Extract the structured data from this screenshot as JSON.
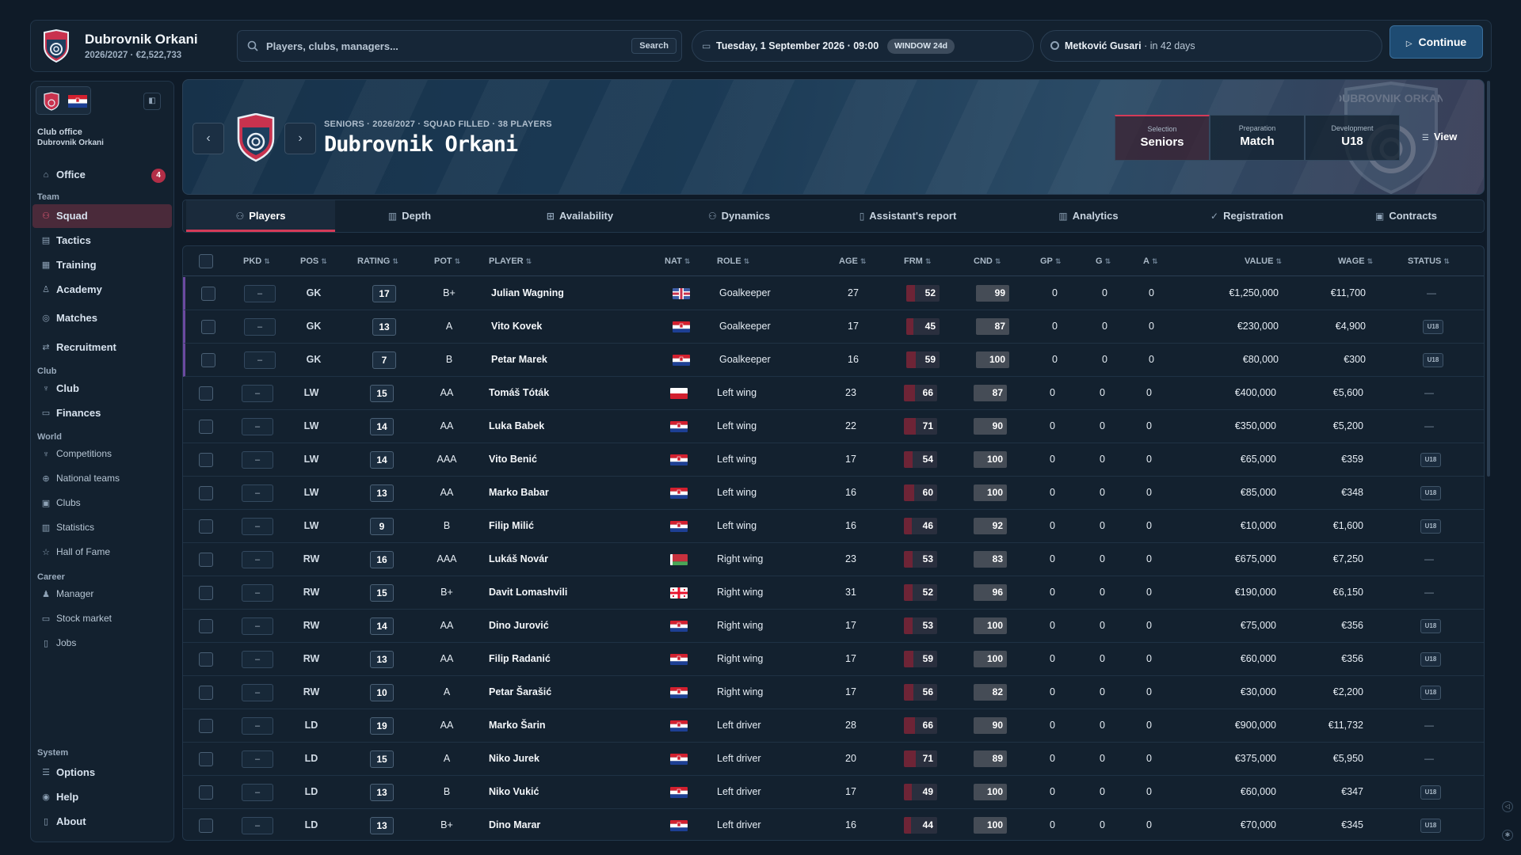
{
  "header": {
    "club_name": "Dubrovnik Orkani",
    "club_meta": "2026/2027 · €2,522,733",
    "search_placeholder": "Players, clubs, managers...",
    "search_button": "Search",
    "date": "Tuesday, 1 September 2026 · 09:00",
    "window_badge": "WINDOW 24d",
    "next_opponent": "Metković Gusari",
    "next_when": "· in 42 days",
    "continue_label": "Continue"
  },
  "sidebar": {
    "office_label": "Club office",
    "office_sub": "Dubrovnik Orkani",
    "office_item": "Office",
    "office_badge": "4",
    "sec_team": "Team",
    "squad": "Squad",
    "tactics": "Tactics",
    "training": "Training",
    "academy": "Academy",
    "matches": "Matches",
    "recruitment": "Recruitment",
    "sec_club": "Club",
    "club": "Club",
    "finances": "Finances",
    "sec_world": "World",
    "competitions": "Competitions",
    "national_teams": "National teams",
    "clubs": "Clubs",
    "statistics": "Statistics",
    "hall_of_fame": "Hall of Fame",
    "sec_career": "Career",
    "manager": "Manager",
    "stock_market": "Stock market",
    "jobs": "Jobs",
    "sec_system": "System",
    "options": "Options",
    "help": "Help",
    "about": "About"
  },
  "hero": {
    "meta": "SENIORS · 2026/2027 · SQUAD FILLED · 38 PLAYERS",
    "title": "Dubrovnik Orkani",
    "seg_selection_k": "Selection",
    "seg_selection_v": "Seniors",
    "seg_preparation_k": "Preparation",
    "seg_preparation_v": "Match",
    "seg_development_k": "Development",
    "seg_development_v": "U18",
    "view_label": "View",
    "watermark_text": "DUBROVNIK ORKANI"
  },
  "tabs": {
    "players": "Players",
    "depth": "Depth",
    "availability": "Availability",
    "dynamics": "Dynamics",
    "assistants_report": "Assistant's report",
    "analytics": "Analytics",
    "registration": "Registration",
    "contracts": "Contracts"
  },
  "columns": {
    "pkd": "PKD",
    "pos": "POS",
    "rating": "RATING",
    "pot": "POT",
    "player": "PLAYER",
    "nat": "NAT",
    "role": "ROLE",
    "age": "AGE",
    "frm": "FRM",
    "cnd": "CND",
    "gp": "GP",
    "g": "G",
    "a": "A",
    "value": "VALUE",
    "wage": "WAGE",
    "status": "STATUS"
  },
  "status_u18_label": "U18",
  "colors": {
    "accent": "#d43b58",
    "background": "#0f1b28",
    "panel": "#13212f"
  },
  "players": [
    {
      "pkd": "–",
      "pos": "GK",
      "rating": "17",
      "pot": "B+",
      "name": "Julian Wagning",
      "nat": "nl",
      "role": "Goalkeeper",
      "age": "27",
      "frm": 52,
      "cnd": "99",
      "gp": "0",
      "g": "0",
      "a": "0",
      "value": "€1,250,000",
      "wage": "€11,700",
      "status": "—"
    },
    {
      "pkd": "–",
      "pos": "GK",
      "rating": "13",
      "pot": "A",
      "name": "Vito Kovek",
      "nat": "hr",
      "role": "Goalkeeper",
      "age": "17",
      "frm": 45,
      "cnd": "87",
      "gp": "0",
      "g": "0",
      "a": "0",
      "value": "€230,000",
      "wage": "€4,900",
      "status": "U18"
    },
    {
      "pkd": "–",
      "pos": "GK",
      "rating": "7",
      "pot": "B",
      "name": "Petar Marek",
      "nat": "hr",
      "role": "Goalkeeper",
      "age": "16",
      "frm": 59,
      "cnd": "100",
      "gp": "0",
      "g": "0",
      "a": "0",
      "value": "€80,000",
      "wage": "€300",
      "status": "U18"
    },
    {
      "pkd": "–",
      "pos": "LW",
      "rating": "15",
      "pot": "AA",
      "name": "Tomáš Tóták",
      "nat": "pl",
      "role": "Left wing",
      "age": "23",
      "frm": 66,
      "cnd": "87",
      "gp": "0",
      "g": "0",
      "a": "0",
      "value": "€400,000",
      "wage": "€5,600",
      "status": "—"
    },
    {
      "pkd": "–",
      "pos": "LW",
      "rating": "14",
      "pot": "AA",
      "name": "Luka Babek",
      "nat": "hr",
      "role": "Left wing",
      "age": "22",
      "frm": 71,
      "cnd": "90",
      "gp": "0",
      "g": "0",
      "a": "0",
      "value": "€350,000",
      "wage": "€5,200",
      "status": "—"
    },
    {
      "pkd": "–",
      "pos": "LW",
      "rating": "14",
      "pot": "AAA",
      "name": "Vito Benić",
      "nat": "hr",
      "role": "Left wing",
      "age": "17",
      "frm": 54,
      "cnd": "100",
      "gp": "0",
      "g": "0",
      "a": "0",
      "value": "€65,000",
      "wage": "€359",
      "status": "U18"
    },
    {
      "pkd": "–",
      "pos": "LW",
      "rating": "13",
      "pot": "AA",
      "name": "Marko Babar",
      "nat": "hr",
      "role": "Left wing",
      "age": "16",
      "frm": 60,
      "cnd": "100",
      "gp": "0",
      "g": "0",
      "a": "0",
      "value": "€85,000",
      "wage": "€348",
      "status": "U18"
    },
    {
      "pkd": "–",
      "pos": "LW",
      "rating": "9",
      "pot": "B",
      "name": "Filip Milić",
      "nat": "hr",
      "role": "Left wing",
      "age": "16",
      "frm": 46,
      "cnd": "92",
      "gp": "0",
      "g": "0",
      "a": "0",
      "value": "€10,000",
      "wage": "€1,600",
      "status": "U18"
    },
    {
      "pkd": "–",
      "pos": "RW",
      "rating": "16",
      "pot": "AAA",
      "name": "Lukáš Novár",
      "nat": "by",
      "role": "Right wing",
      "age": "23",
      "frm": 53,
      "cnd": "83",
      "gp": "0",
      "g": "0",
      "a": "0",
      "value": "€675,000",
      "wage": "€7,250",
      "status": "—"
    },
    {
      "pkd": "–",
      "pos": "RW",
      "rating": "15",
      "pot": "B+",
      "name": "Davit Lomashvili",
      "nat": "ge",
      "role": "Right wing",
      "age": "31",
      "frm": 52,
      "cnd": "96",
      "gp": "0",
      "g": "0",
      "a": "0",
      "value": "€190,000",
      "wage": "€6,150",
      "status": "—"
    },
    {
      "pkd": "–",
      "pos": "RW",
      "rating": "14",
      "pot": "AA",
      "name": "Dino Jurović",
      "nat": "hr",
      "role": "Right wing",
      "age": "17",
      "frm": 53,
      "cnd": "100",
      "gp": "0",
      "g": "0",
      "a": "0",
      "value": "€75,000",
      "wage": "€356",
      "status": "U18"
    },
    {
      "pkd": "–",
      "pos": "RW",
      "rating": "13",
      "pot": "AA",
      "name": "Filip Radanić",
      "nat": "hr",
      "role": "Right wing",
      "age": "17",
      "frm": 59,
      "cnd": "100",
      "gp": "0",
      "g": "0",
      "a": "0",
      "value": "€60,000",
      "wage": "€356",
      "status": "U18"
    },
    {
      "pkd": "–",
      "pos": "RW",
      "rating": "10",
      "pot": "A",
      "name": "Petar Šarašić",
      "nat": "hr",
      "role": "Right wing",
      "age": "17",
      "frm": 56,
      "cnd": "82",
      "gp": "0",
      "g": "0",
      "a": "0",
      "value": "€30,000",
      "wage": "€2,200",
      "status": "U18"
    },
    {
      "pkd": "–",
      "pos": "LD",
      "rating": "19",
      "pot": "AA",
      "name": "Marko Šarin",
      "nat": "hr",
      "role": "Left driver",
      "age": "28",
      "frm": 66,
      "cnd": "90",
      "gp": "0",
      "g": "0",
      "a": "0",
      "value": "€900,000",
      "wage": "€11,732",
      "status": "—"
    },
    {
      "pkd": "–",
      "pos": "LD",
      "rating": "15",
      "pot": "A",
      "name": "Niko Jurek",
      "nat": "hr",
      "role": "Left driver",
      "age": "20",
      "frm": 71,
      "cnd": "89",
      "gp": "0",
      "g": "0",
      "a": "0",
      "value": "€375,000",
      "wage": "€5,950",
      "status": "—"
    },
    {
      "pkd": "–",
      "pos": "LD",
      "rating": "13",
      "pot": "B",
      "name": "Niko Vukić",
      "nat": "hr",
      "role": "Left driver",
      "age": "17",
      "frm": 49,
      "cnd": "100",
      "gp": "0",
      "g": "0",
      "a": "0",
      "value": "€60,000",
      "wage": "€347",
      "status": "U18"
    },
    {
      "pkd": "–",
      "pos": "LD",
      "rating": "13",
      "pot": "B+",
      "name": "Dino Marar",
      "nat": "hr",
      "role": "Left driver",
      "age": "16",
      "frm": 44,
      "cnd": "100",
      "gp": "0",
      "g": "0",
      "a": "0",
      "value": "€70,000",
      "wage": "€345",
      "status": "U18"
    }
  ]
}
